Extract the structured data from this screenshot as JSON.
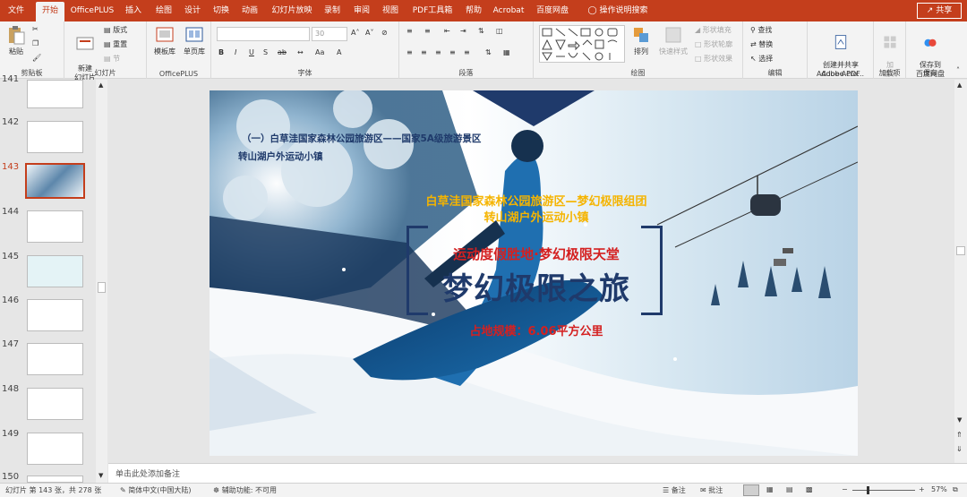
{
  "tabs": [
    {
      "label": "文件",
      "active": false
    },
    {
      "label": "开始",
      "active": true
    },
    {
      "label": "OfficePLUS",
      "active": false
    },
    {
      "label": "插入",
      "active": false
    },
    {
      "label": "绘图",
      "active": false
    },
    {
      "label": "设计",
      "active": false
    },
    {
      "label": "切换",
      "active": false
    },
    {
      "label": "动画",
      "active": false
    },
    {
      "label": "幻灯片放映",
      "active": false
    },
    {
      "label": "录制",
      "active": false
    },
    {
      "label": "审阅",
      "active": false
    },
    {
      "label": "视图",
      "active": false
    },
    {
      "label": "PDF工具箱",
      "active": false
    },
    {
      "label": "帮助",
      "active": false
    },
    {
      "label": "Acrobat",
      "active": false
    },
    {
      "label": "百度网盘",
      "active": false
    }
  ],
  "tellme": "操作说明搜索",
  "share": "共享",
  "ribbon": {
    "clipboard": {
      "label": "剪贴板",
      "paste": "粘贴"
    },
    "slides": {
      "label": "幻灯片",
      "new_slide": "新建\n幻灯片",
      "layout": "版式",
      "reset": "重置",
      "section": "节"
    },
    "officeplus": {
      "label": "OfficePLUS",
      "template": "模板库",
      "single_page": "单页库"
    },
    "font": {
      "label": "字体",
      "size": "30"
    },
    "paragraph": {
      "label": "段落"
    },
    "drawing": {
      "label": "绘图",
      "arrange": "排列",
      "quick_styles": "快速样式",
      "fill": "形状填充",
      "outline": "形状轮廓",
      "effects": "形状效果"
    },
    "editing": {
      "label": "编辑",
      "find": "查找",
      "replace": "替换",
      "select": "选择"
    },
    "adobe": {
      "label": "Adobe Acro...",
      "create": "创建并共享\nAdobe PDF"
    },
    "addins": {
      "label": "加载项",
      "add": "加\n载项"
    },
    "save": {
      "label": "保存",
      "baidu": "保存到\n百度网盘"
    }
  },
  "thumbnails": [
    {
      "num": "141",
      "current": false
    },
    {
      "num": "142",
      "current": false
    },
    {
      "num": "143",
      "current": true
    },
    {
      "num": "144",
      "current": false
    },
    {
      "num": "145",
      "current": false
    },
    {
      "num": "146",
      "current": false
    },
    {
      "num": "147",
      "current": false
    },
    {
      "num": "148",
      "current": false
    },
    {
      "num": "149",
      "current": false
    },
    {
      "num": "150",
      "current": false
    }
  ],
  "slide": {
    "heading_line1": "（一）白草洼国家森林公园旅游区——国家5A级旅游景区",
    "heading_line2": "转山湖户外运动小镇",
    "subtitle_line1": "白草洼国家森林公园旅游区—梦幻极限组团",
    "subtitle_line2": "转山湖户外运动小镇",
    "tagline": "运动度假胜地·梦幻极限天堂",
    "main_title": "梦幻极限之旅",
    "area": "占地规模：6.06平方公里",
    "colors": {
      "navy": "#1f3a6b",
      "gold": "#f5b400",
      "red": "#d42020"
    }
  },
  "notes_placeholder": "单击此处添加备注",
  "status": {
    "slide_info": "幻灯片 第 143 张，共 278 张",
    "language": "简体中文(中国大陆)",
    "accessibility": "辅助功能: 不可用",
    "notes": "备注",
    "comments": "批注",
    "zoom": "57%"
  },
  "accent": "#c43e1c"
}
